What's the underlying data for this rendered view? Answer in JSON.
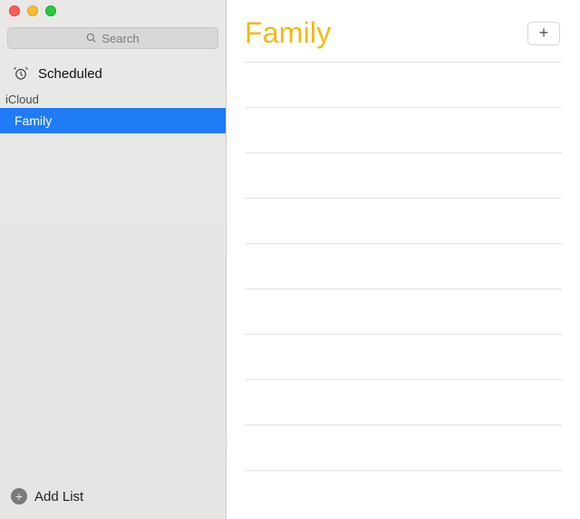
{
  "search": {
    "placeholder": "Search"
  },
  "sidebar": {
    "scheduled_label": "Scheduled",
    "section_label": "iCloud",
    "lists": [
      {
        "name": "Family",
        "selected": true
      }
    ],
    "add_list_label": "Add List"
  },
  "main": {
    "title": "Family"
  },
  "colors": {
    "selection": "#1f7bf6",
    "accent": "#f2b90f"
  }
}
